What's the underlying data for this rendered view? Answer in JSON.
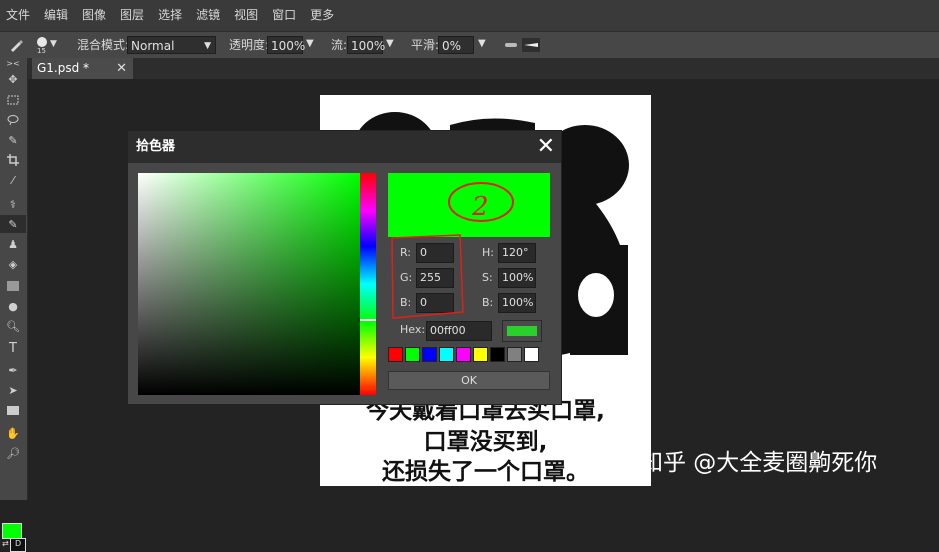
{
  "menu": [
    "文件",
    "编辑",
    "图像",
    "图层",
    "选择",
    "滤镜",
    "视图",
    "窗口",
    "更多"
  ],
  "options": {
    "brush_size": "15",
    "blend_label": "混合模式:",
    "blend_value": "Normal",
    "opacity_label": "透明度:",
    "opacity_value": "100%",
    "flow_label": "流:",
    "flow_value": "100%",
    "smooth_label": "平滑:",
    "smooth_value": "0%"
  },
  "tab": {
    "name": "G1.psd *",
    "close": "✕"
  },
  "canvas": {
    "line1": "今天戴着口罩去买口罩,",
    "line2": "口罩没买到,",
    "line3": "还损失了一个口罩。"
  },
  "watermark": "知乎 @大全麦圈齁死你",
  "picker": {
    "title": "拾色器",
    "close": "✕",
    "preview_color": "#00ff00",
    "r_label": "R:",
    "r_value": "0",
    "g_label": "G:",
    "g_value": "255",
    "b_label": "B:",
    "b_value": "0",
    "h_label": "H:",
    "h_value": "120°",
    "s_label": "S:",
    "s_value": "100%",
    "v_label": "B:",
    "v_value": "100%",
    "hex_label": "Hex:",
    "hex_value": "00ff00",
    "swatches": [
      "#ff0000",
      "#00ff00",
      "#0000ff",
      "#00ffff",
      "#ff00ff",
      "#ffff00",
      "#000000",
      "#808080",
      "#ffffff"
    ],
    "ok": "OK"
  },
  "annotation": {
    "number": "2"
  },
  "colors": {
    "foreground": "#00ff00",
    "background": "#111111"
  }
}
